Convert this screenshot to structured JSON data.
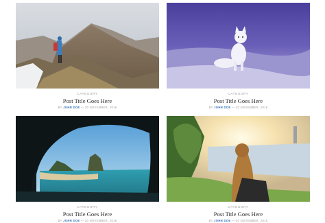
{
  "posts": [
    {
      "image": "mountain-hiker-photo",
      "category": "CATEGORY",
      "title": "Post Title Goes Here",
      "by": "BY",
      "author": "JOHN DOE",
      "date_sep": " — ",
      "date": "20 NOVEMBER, 2016"
    },
    {
      "image": "arctic-fox-snow-photo",
      "category": "CATEGORY",
      "title": "Post Title Goes Here",
      "by": "BY",
      "author": "JOHN DOE",
      "date_sep": " — ",
      "date": "20 NOVEMBER, 2016"
    },
    {
      "image": "sea-cave-beach-photo",
      "category": "CATEGORY",
      "title": "Post Title Goes Here",
      "by": "BY",
      "author": "JOHN DOE",
      "date_sep": " — ",
      "date": "20 NOVEMBER, 2016"
    },
    {
      "image": "woman-sunset-lake-photo",
      "category": "CATEGORY",
      "title": "Post Title Goes Here",
      "by": "BY",
      "author": "JOHN DOE",
      "date_sep": " — ",
      "date": "20 NOVEMBER, 2016"
    }
  ],
  "colors": {
    "author_link": "#2f6fb6",
    "meta_text": "#9a9a9a",
    "title_text": "#2b2b2b"
  }
}
